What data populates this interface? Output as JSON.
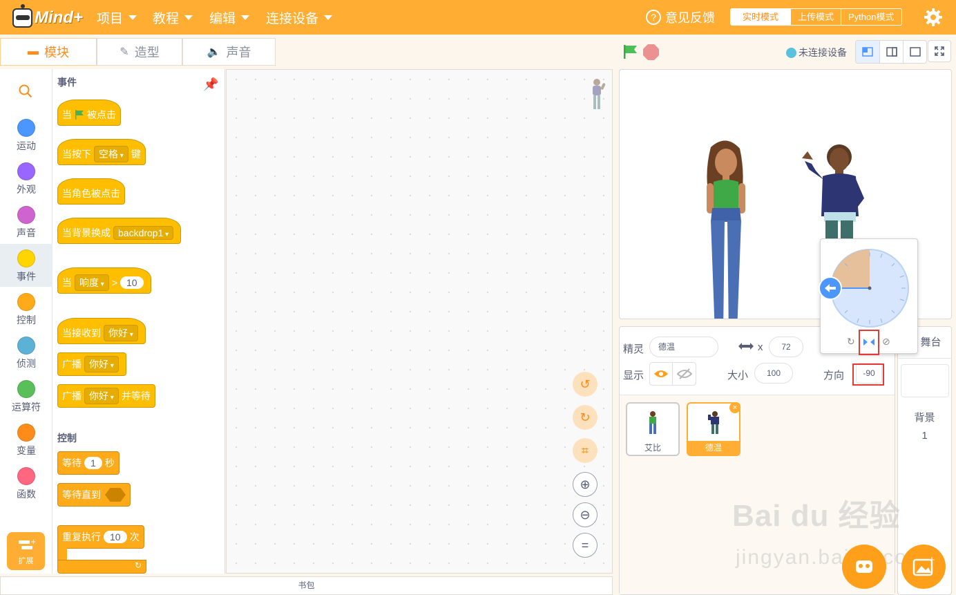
{
  "brand": {
    "name": "Mind+"
  },
  "menu": [
    {
      "label": "项目"
    },
    {
      "label": "教程"
    },
    {
      "label": "编辑"
    },
    {
      "label": "连接设备"
    }
  ],
  "header": {
    "feedback": "意见反馈",
    "modes": [
      "实时模式",
      "上传模式",
      "Python模式"
    ],
    "active_mode": "实时模式"
  },
  "tabs": [
    {
      "label": "模块"
    },
    {
      "label": "造型"
    },
    {
      "label": "声音"
    }
  ],
  "categories": [
    {
      "label": "运动",
      "color": "#4c97ff"
    },
    {
      "label": "外观",
      "color": "#9966ff"
    },
    {
      "label": "声音",
      "color": "#cf63cf"
    },
    {
      "label": "事件",
      "color": "#ffd500"
    },
    {
      "label": "控制",
      "color": "#ffab19"
    },
    {
      "label": "侦测",
      "color": "#5cb1d6"
    },
    {
      "label": "运算符",
      "color": "#59c059"
    },
    {
      "label": "变量",
      "color": "#ff8c1a"
    },
    {
      "label": "函数",
      "color": "#ff6680"
    }
  ],
  "extension_label": "扩展",
  "palette": {
    "events_title": "事件",
    "control_title": "控制",
    "when_flag": {
      "a": "当",
      "b": "被点击"
    },
    "when_key": {
      "a": "当按下",
      "key": "空格",
      "b": "键"
    },
    "when_sprite_clicked": "当角色被点击",
    "when_backdrop": {
      "a": "当背景换成",
      "dd": "backdrop1"
    },
    "when_loudness": {
      "a": "当",
      "dd": "响度",
      "op": ">",
      "num": "10"
    },
    "when_receive": {
      "a": "当接收到",
      "dd": "你好"
    },
    "broadcast": {
      "a": "广播",
      "dd": "你好"
    },
    "broadcast_wait": {
      "a": "广播",
      "dd": "你好",
      "b": "并等待"
    },
    "wait": {
      "a": "等待",
      "num": "1",
      "b": "秒"
    },
    "wait_until": {
      "a": "等待直到"
    },
    "repeat": {
      "a": "重复执行",
      "num": "10",
      "b": "次"
    }
  },
  "backpack_label": "书包",
  "stage_header": {
    "device_status": "未连接设备"
  },
  "sprite_info": {
    "sprite_label": "精灵",
    "sprite_name": "德温",
    "x_label": "x",
    "x_value": "72",
    "show_label": "显示",
    "size_label": "大小",
    "size_value": "100",
    "direction_label": "方向",
    "direction_value": "-90"
  },
  "sprites": [
    {
      "name": "艾比",
      "selected": false
    },
    {
      "name": "德温",
      "selected": true
    }
  ],
  "stage_panel": {
    "title": "舞台",
    "backdrop_label": "背景",
    "backdrop_count": "1"
  },
  "watermark": {
    "line1": "Bai du 经验",
    "line2": "jingyan.baidu.com"
  }
}
